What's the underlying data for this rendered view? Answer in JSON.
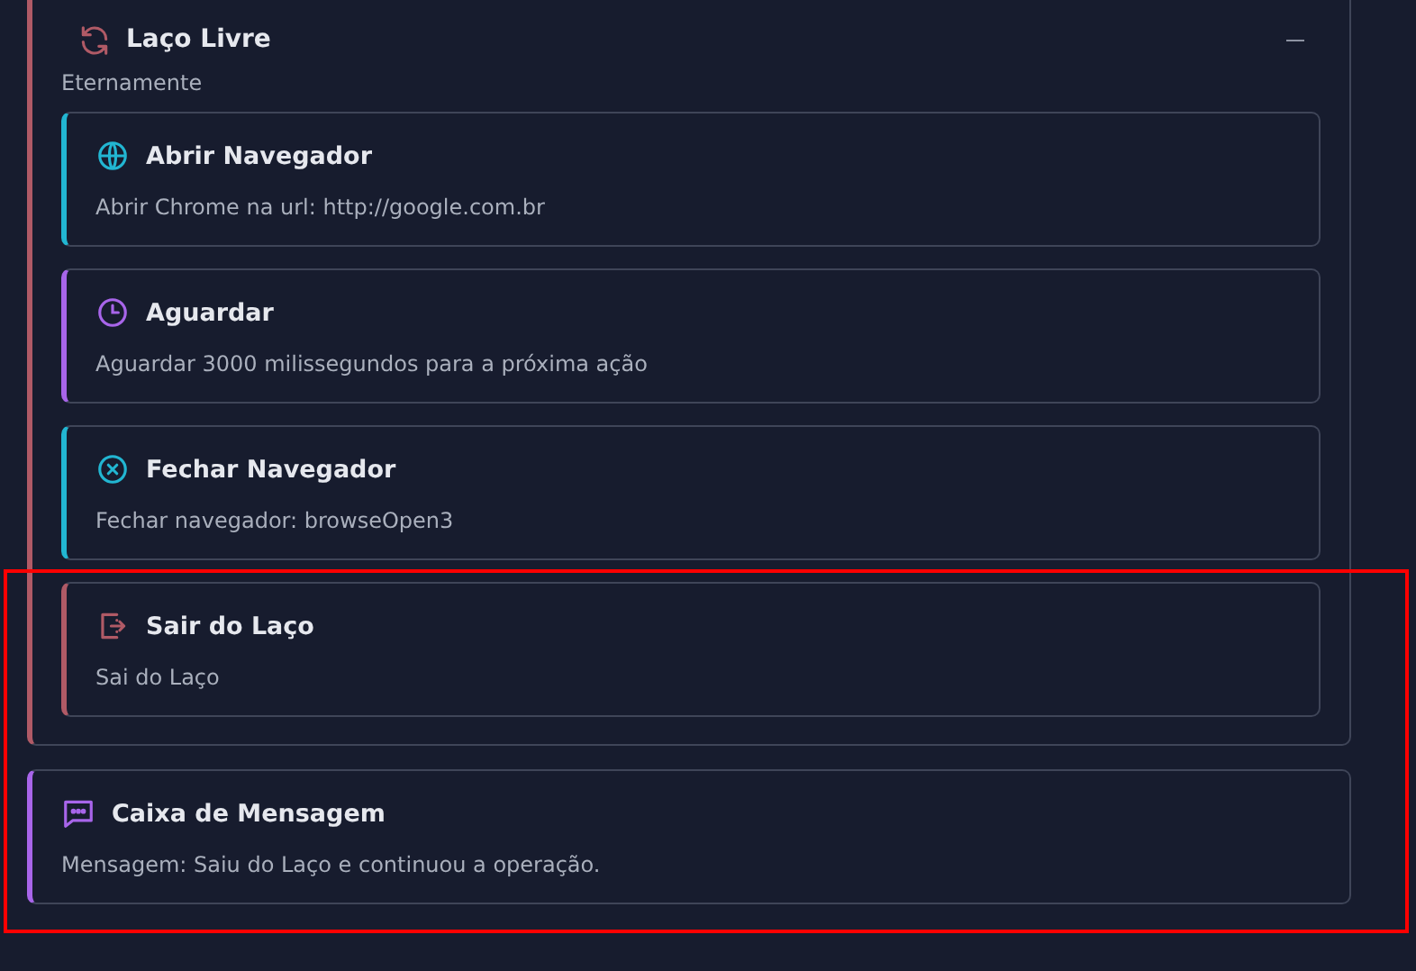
{
  "loop": {
    "title": "Laço Livre",
    "subtitle": "Eternamente",
    "color": "#b05a66",
    "expanded": true,
    "steps": [
      {
        "kind": "globe",
        "title": "Abrir Navegador",
        "description": "Abrir Chrome na url: http://google.com.br",
        "color": "#22b6d2"
      },
      {
        "kind": "clock",
        "title": "Aguardar",
        "description": "Aguardar 3000 milissegundos para a próxima ação",
        "color": "#a865ea"
      },
      {
        "kind": "close",
        "title": "Fechar Navegador",
        "description": "Fechar navegador: browseOpen3",
        "color": "#22b6d2"
      },
      {
        "kind": "exit",
        "title": "Sair do Laço",
        "description": "Sai do Laço",
        "color": "#b05a66"
      }
    ]
  },
  "message_step": {
    "kind": "message",
    "title": "Caixa de Mensagem",
    "description": "Mensagem: Saiu do Laço e continuou a operação.",
    "color": "#a865ea"
  }
}
